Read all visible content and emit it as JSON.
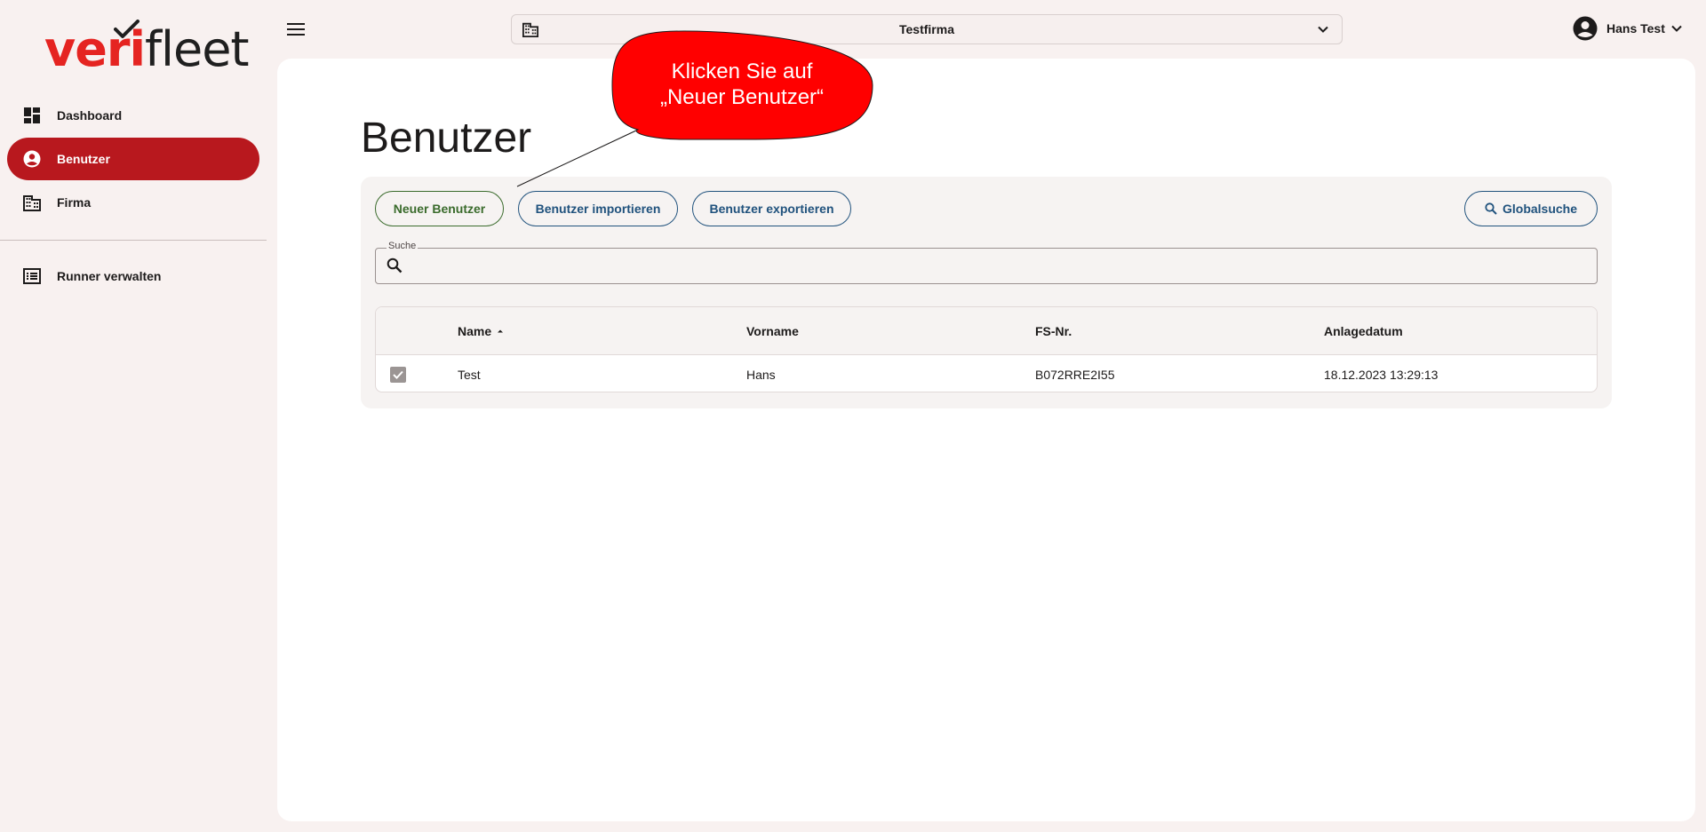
{
  "app": {
    "logo_part1": "veri",
    "logo_part2": "fleet",
    "brand_color": "#e52421",
    "accent_color": "#b8181e"
  },
  "sidebar": {
    "items": [
      {
        "label": "Dashboard",
        "icon": "dashboard-icon",
        "active": false
      },
      {
        "label": "Benutzer",
        "icon": "account-circle-icon",
        "active": true
      },
      {
        "label": "Firma",
        "icon": "building-icon",
        "active": false
      }
    ],
    "secondary_items": [
      {
        "label": "Runner verwalten",
        "icon": "list-alt-icon",
        "active": false
      }
    ]
  },
  "header": {
    "menu_icon": "hamburger-menu-icon",
    "company": "Testfirma",
    "user_name": "Hans Test"
  },
  "main": {
    "title": "Benutzer",
    "toolbar": {
      "new_user": "Neuer Benutzer",
      "import_users": "Benutzer importieren",
      "export_users": "Benutzer exportieren",
      "global_search": "Globalsuche"
    },
    "search": {
      "label": "Suche",
      "value": ""
    },
    "table": {
      "columns": [
        "Name",
        "Vorname",
        "FS-Nr.",
        "Anlagedatum"
      ],
      "sort_column": "Name",
      "sort_direction": "ascending",
      "rows": [
        {
          "selected": true,
          "cells": [
            "Test",
            "Hans",
            "B072RRE2I55",
            "18.12.2023 13:29:13"
          ]
        }
      ]
    }
  },
  "callout": {
    "line1": "Klicken Sie auf",
    "line2": "„Neuer Benutzer“",
    "color": "#ff0000"
  }
}
